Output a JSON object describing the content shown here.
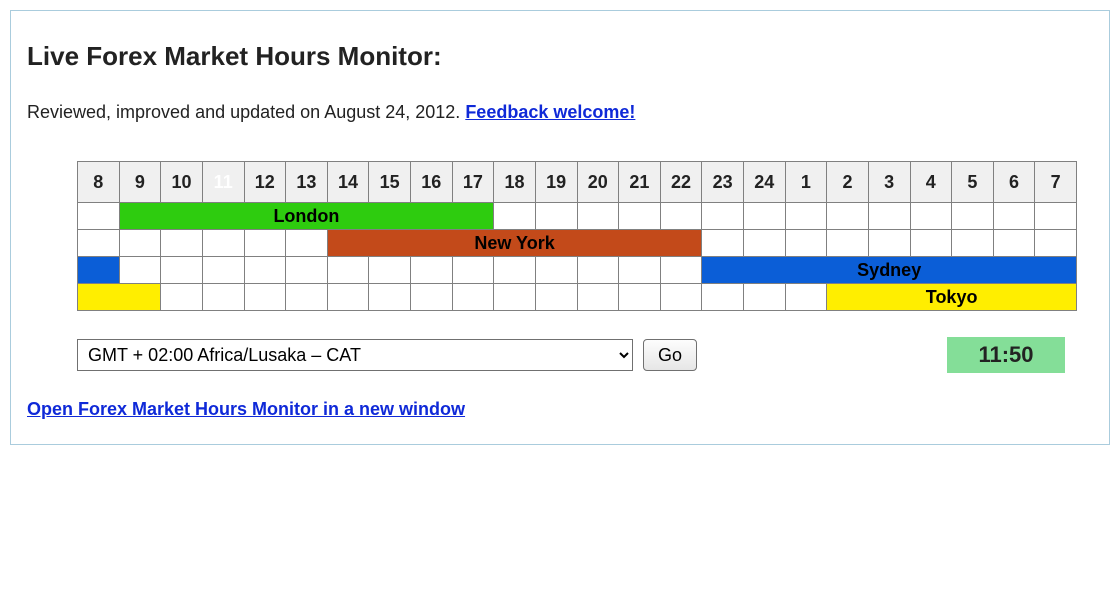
{
  "title": "Live Forex Market Hours Monitor:",
  "intro_text": "Reviewed, improved and updated on August 24, 2012. ",
  "feedback_link": "Feedback welcome!",
  "hours_header": [
    "8",
    "9",
    "10",
    "11",
    "12",
    "13",
    "14",
    "15",
    "16",
    "17",
    "18",
    "19",
    "20",
    "21",
    "22",
    "23",
    "24",
    "1",
    "2",
    "3",
    "4",
    "5",
    "6",
    "7"
  ],
  "current_hour_index": 3,
  "markets": {
    "london": {
      "label": "London"
    },
    "newyork": {
      "label": "New York"
    },
    "sydney": {
      "label": "Sydney"
    },
    "tokyo": {
      "label": "Tokyo"
    }
  },
  "timezone_options": [
    "GMT + 02:00      Africa/Lusaka – CAT"
  ],
  "selected_timezone": "GMT + 02:00      Africa/Lusaka – CAT",
  "go_label": "Go",
  "clock": "11:50",
  "open_link": "Open Forex Market Hours Monitor in a new window",
  "chart_data": {
    "type": "bar",
    "title": "Live Forex Market Hours Monitor",
    "x_hours": [
      8,
      9,
      10,
      11,
      12,
      13,
      14,
      15,
      16,
      17,
      18,
      19,
      20,
      21,
      22,
      23,
      24,
      1,
      2,
      3,
      4,
      5,
      6,
      7
    ],
    "current_hour": 11,
    "series": [
      {
        "name": "London",
        "open_index": 1,
        "span": 9,
        "wrap_from_start_span": 0
      },
      {
        "name": "New York",
        "open_index": 6,
        "span": 9,
        "wrap_from_start_span": 0
      },
      {
        "name": "Sydney",
        "open_index": 15,
        "span": 9,
        "wrap_from_start_span": 1
      },
      {
        "name": "Tokyo",
        "open_index": 18,
        "span": 6,
        "wrap_from_start_span": 2
      }
    ],
    "note": "open_index is 0-based into x_hours; each market session is 9h except Tokyo shown 8h; wrap_from_start_span is the portion of the bar that wraps to the left edge (previous-day spillover)."
  }
}
